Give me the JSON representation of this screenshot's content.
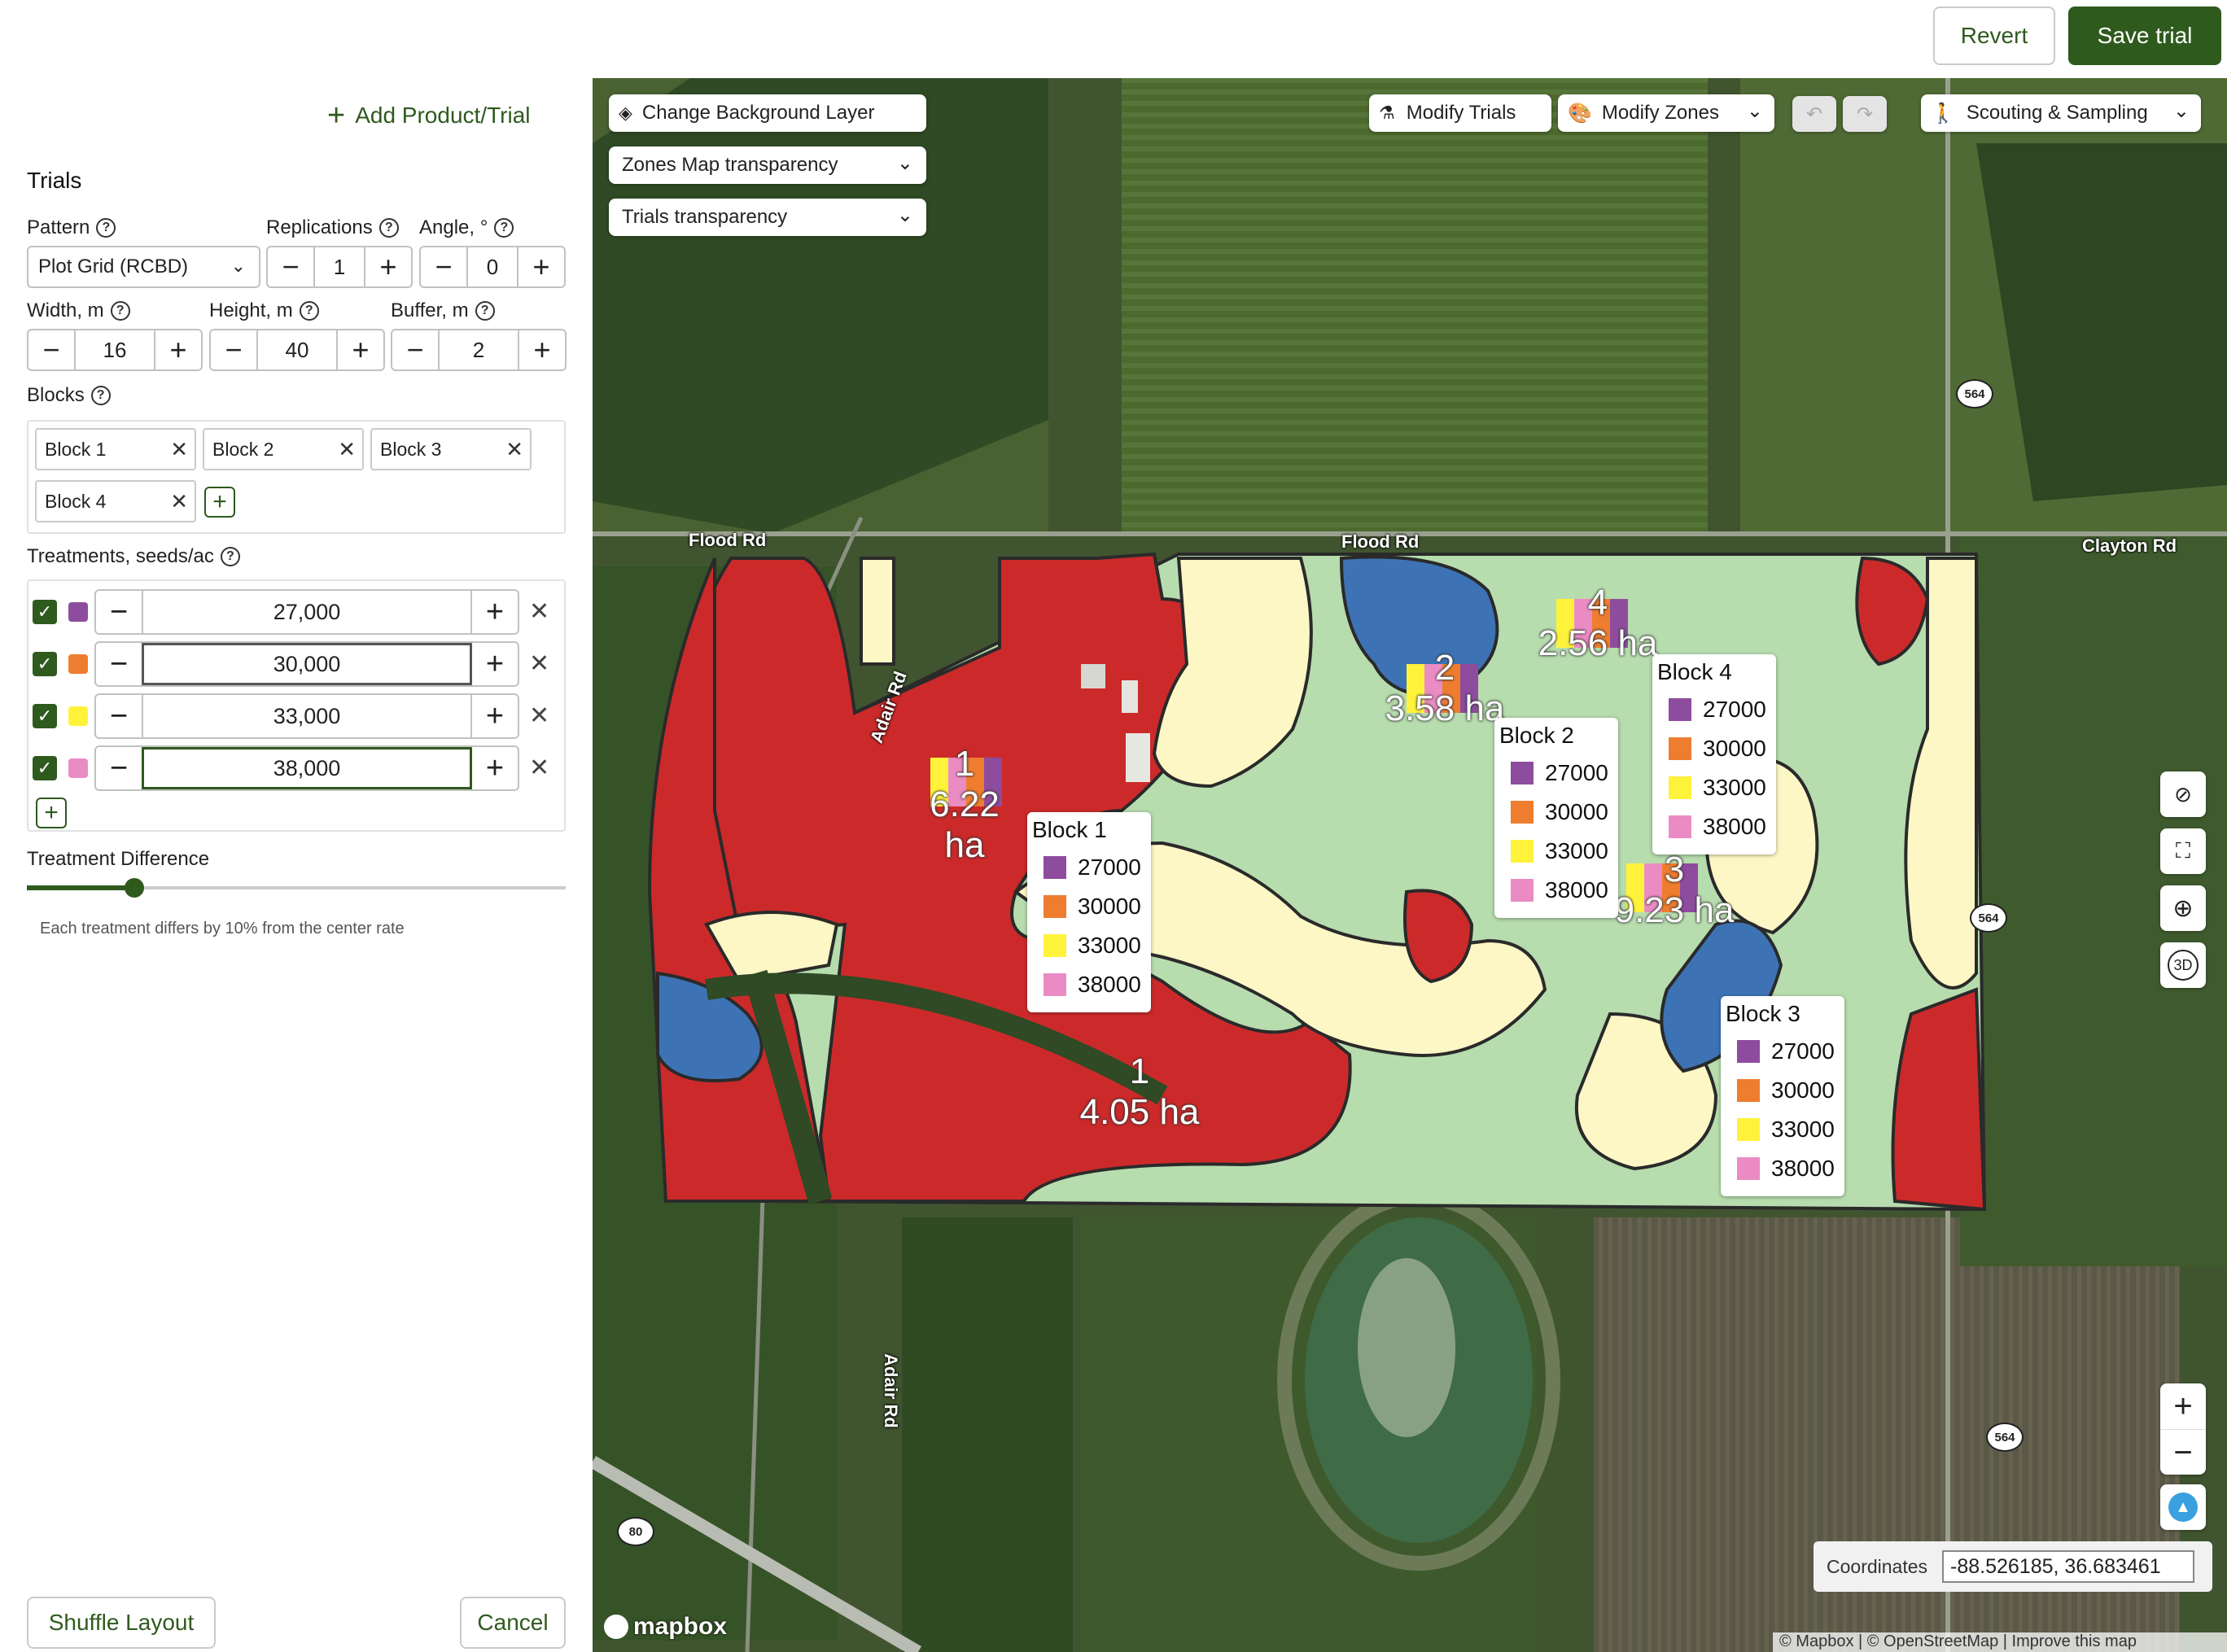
{
  "header": {
    "revert_label": "Revert",
    "save_label": "Save trial"
  },
  "panel": {
    "add_product_label": "Add Product/Trial",
    "section_title": "Trials",
    "pattern": {
      "label": "Pattern",
      "value": "Plot Grid (RCBD)"
    },
    "replications": {
      "label": "Replications",
      "value": "1"
    },
    "angle": {
      "label": "Angle, °",
      "value": "0"
    },
    "width": {
      "label": "Width, m",
      "value": "16"
    },
    "height": {
      "label": "Height, m",
      "value": "40"
    },
    "buffer": {
      "label": "Buffer, m",
      "value": "2"
    },
    "blocks_label": "Blocks",
    "blocks": [
      "Block 1",
      "Block 2",
      "Block 3",
      "Block 4"
    ],
    "treatments_label": "Treatments, seeds/ac",
    "treatments": [
      {
        "value": "27,000",
        "color": "#8e4c9e"
      },
      {
        "value": "30,000",
        "color": "#ee7d2f"
      },
      {
        "value": "33,000",
        "color": "#fff23a"
      },
      {
        "value": "38,000",
        "color": "#ea8cc3"
      }
    ],
    "treatment_difference_label": "Treatment Difference",
    "treatment_difference_fraction": 0.2,
    "treatment_difference_help": "Each treatment differs by 10% from the center rate",
    "shuffle_label": "Shuffle Layout",
    "cancel_label": "Cancel"
  },
  "map": {
    "change_bg_label": "Change Background Layer",
    "zones_transparency_label": "Zones Map transparency",
    "trials_transparency_label": "Trials transparency",
    "modify_trials_label": "Modify Trials",
    "modify_zones_label": "Modify Zones",
    "scouting_label": "Scouting & Sampling",
    "roads": {
      "flood_rd_1": "Flood Rd",
      "flood_rd_2": "Flood Rd",
      "clayton_rd": "Clayton Rd",
      "adair_rd_1": "Adair Rd",
      "adair_rd_2": "Adair Rd"
    },
    "shields": {
      "s1": "564",
      "s2": "564",
      "s3": "564",
      "s4": "80"
    },
    "zone_labels": [
      {
        "num": "1",
        "area": "6.22 ha"
      },
      {
        "num": "1",
        "area": "4.05 ha"
      },
      {
        "num": "2",
        "area": "3.58 ha"
      },
      {
        "num": "4",
        "area": "2.56 ha"
      },
      {
        "num": "3",
        "area": "9.23 ha"
      }
    ],
    "legends": [
      {
        "title": "Block 1",
        "rates": [
          "27000",
          "30000",
          "33000",
          "38000"
        ]
      },
      {
        "title": "Block 2",
        "rates": [
          "27000",
          "30000",
          "33000",
          "38000"
        ]
      },
      {
        "title": "Block 3",
        "rates": [
          "27000",
          "30000",
          "33000",
          "38000"
        ]
      },
      {
        "title": "Block 4",
        "rates": [
          "27000",
          "30000",
          "33000",
          "38000"
        ]
      }
    ],
    "rate_colors": [
      "#8e4c9e",
      "#ee7d2f",
      "#fff23a",
      "#ea8cc3"
    ],
    "coordinates_label": "Coordinates",
    "coordinates_value": "-88.526185, 36.683461",
    "attribution": "© Mapbox | © OpenStreetMap | Improve this map",
    "logo_label": "mapbox",
    "zoom_in_label": "+",
    "zoom_out_label": "−",
    "btn_3d_label": "3D"
  }
}
